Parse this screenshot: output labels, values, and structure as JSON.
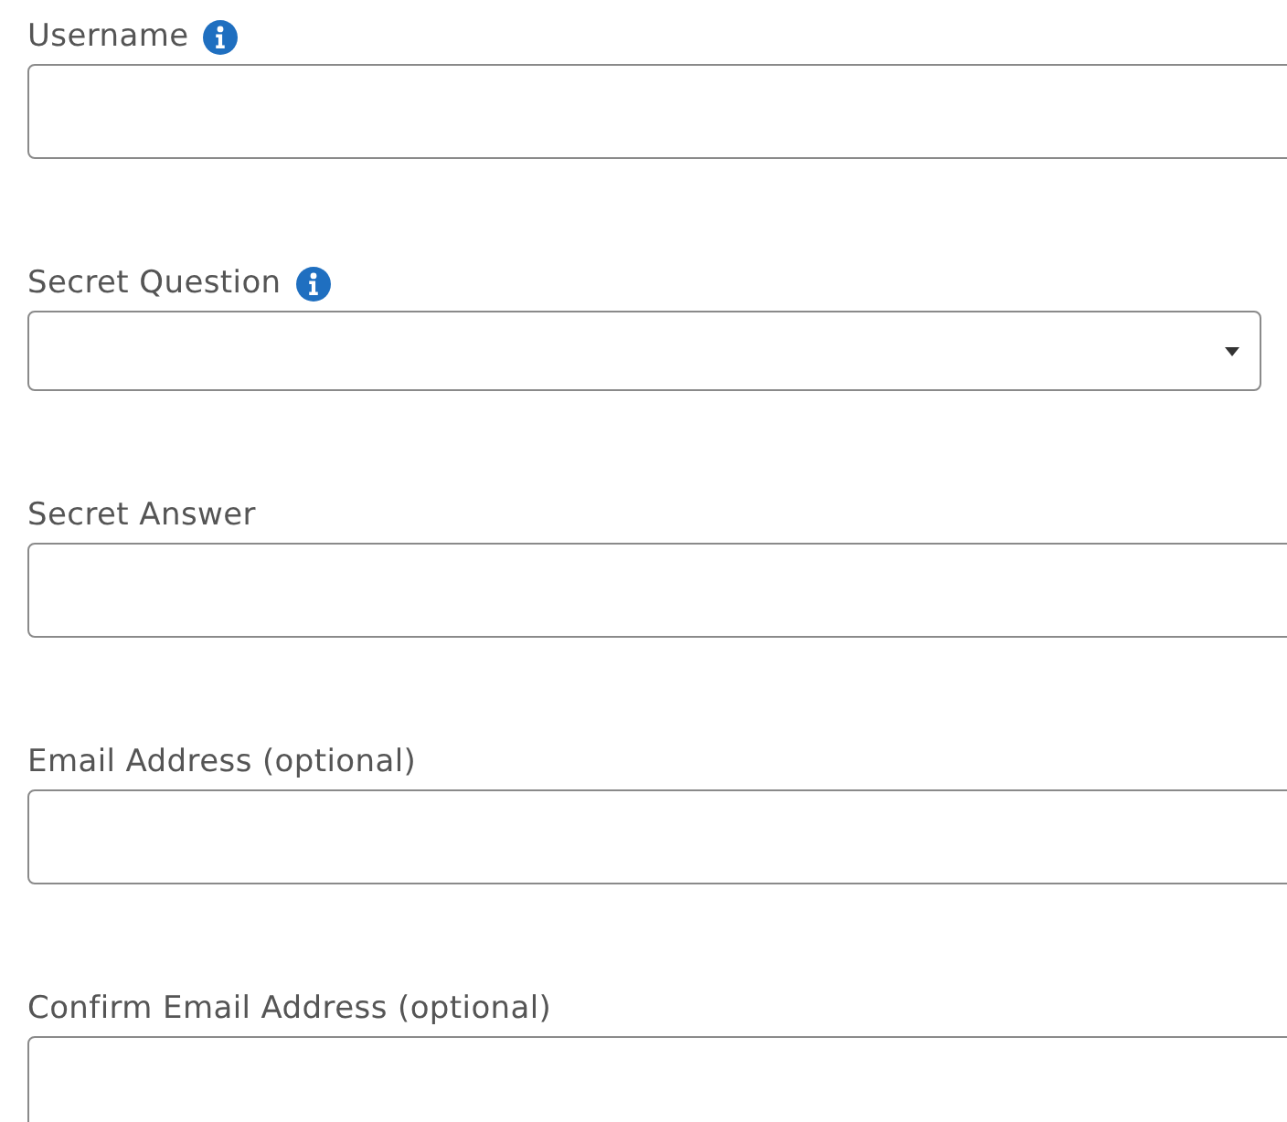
{
  "fields": [
    {
      "label": "Username",
      "info": true,
      "kind": "text"
    },
    {
      "label": "Secret Question",
      "info": true,
      "kind": "select"
    },
    {
      "label": "Secret Answer",
      "info": false,
      "kind": "text"
    },
    {
      "label": "Email Address (optional)",
      "info": false,
      "kind": "text"
    },
    {
      "label": "Confirm Email Address (optional)",
      "info": false,
      "kind": "text"
    }
  ]
}
